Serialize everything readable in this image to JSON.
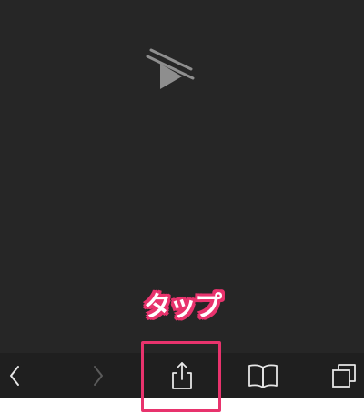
{
  "annotation": {
    "tap_text": "タップ",
    "highlight_color": "#e8336d"
  },
  "video": {
    "icon": "video-unavailable-icon",
    "background": "#262626"
  },
  "toolbar": {
    "items": [
      {
        "icon": "chevron-left-icon",
        "enabled": true
      },
      {
        "icon": "chevron-right-icon",
        "enabled": false
      },
      {
        "icon": "share-icon",
        "enabled": true,
        "highlighted": true
      },
      {
        "icon": "book-icon",
        "enabled": true
      },
      {
        "icon": "tabs-icon",
        "enabled": true
      }
    ],
    "background": "#1f1f1f"
  }
}
